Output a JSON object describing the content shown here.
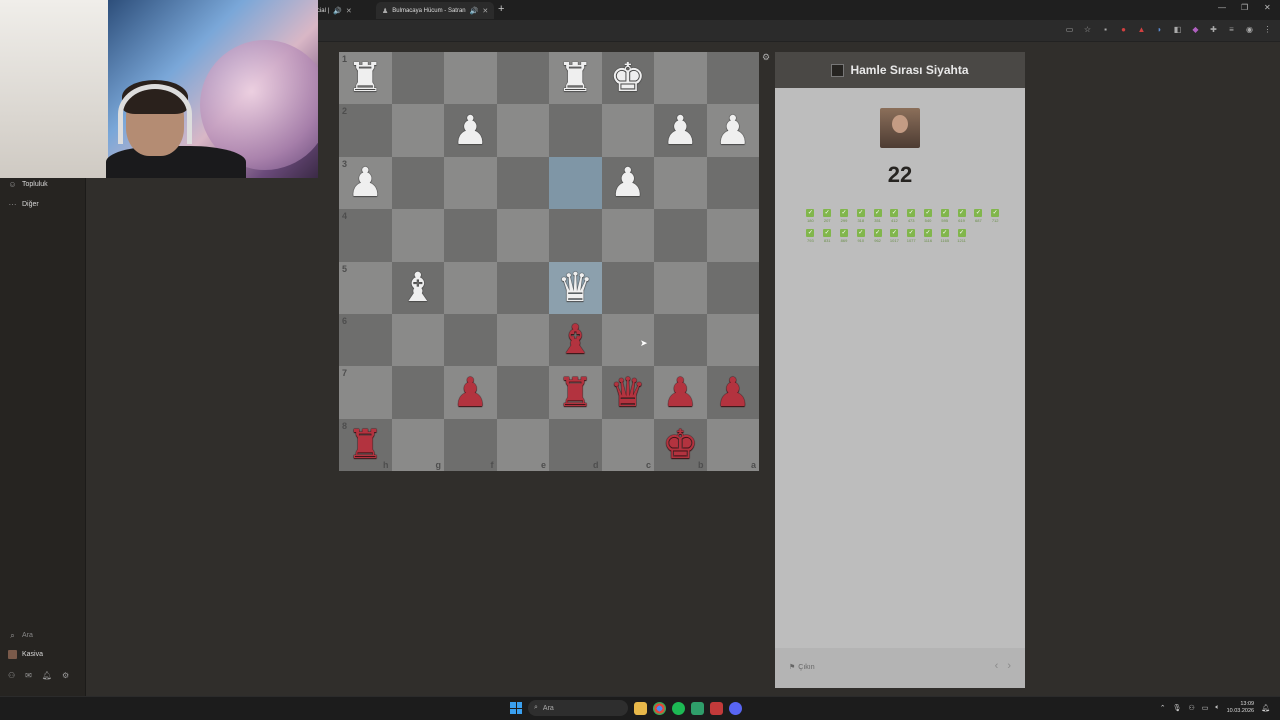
{
  "browser": {
    "tabs": [
      {
        "label": "[Official |",
        "audio": "🔊"
      },
      {
        "label": "Bulmacaya Hücum - Satran",
        "audio": "🔊"
      }
    ],
    "new_tab": "+",
    "window_controls": [
      "—",
      "❐",
      "✕"
    ]
  },
  "sidebar": {
    "items": [
      {
        "icon": "community-icon",
        "label": "Topluluk"
      },
      {
        "icon": "more-icon",
        "label": "Diğer"
      }
    ],
    "search_label": "Ara",
    "user_label": "Kasiva"
  },
  "board": {
    "ranks": [
      "1",
      "2",
      "3",
      "4",
      "5",
      "6",
      "7",
      "8"
    ],
    "files": [
      "h",
      "g",
      "f",
      "e",
      "d",
      "c",
      "b",
      "a"
    ],
    "squares": [
      [
        "♜w",
        "",
        "",
        "",
        "♜w",
        "♚w",
        "",
        ""
      ],
      [
        "",
        "",
        "♟w",
        "",
        "",
        "",
        "♟w",
        "♟w"
      ],
      [
        "♟w",
        "",
        "",
        "",
        "",
        "♟w",
        "",
        ""
      ],
      [
        "",
        "",
        "",
        "",
        "",
        "",
        "",
        ""
      ],
      [
        "",
        "♝w",
        "",
        "",
        "♛w",
        "",
        "",
        ""
      ],
      [
        "",
        "",
        "",
        "",
        "♝b",
        "",
        "",
        ""
      ],
      [
        "",
        "",
        "♟b",
        "",
        "♜b",
        "♛b",
        "♟b",
        "♟b"
      ],
      [
        "♜b",
        "",
        "",
        "",
        "",
        "",
        "♚b",
        ""
      ]
    ],
    "highlighted": [
      [
        2,
        4
      ],
      [
        4,
        4
      ]
    ]
  },
  "panel": {
    "title": "Hamle Sırası Siyahta",
    "score": "22",
    "ratings": [
      "180",
      "207",
      "299",
      "318",
      "351",
      "412",
      "473",
      "540",
      "595",
      "619",
      "687",
      "712",
      "793",
      "831",
      "869",
      "910",
      "962",
      "1017",
      "1077",
      "1116",
      "1165",
      "1211"
    ],
    "exit_label": "Çıkın",
    "prev_arrow": "‹",
    "next_arrow": "›"
  },
  "taskbar": {
    "search_placeholder": "Ara",
    "time": "13:09",
    "date": "10.03.2026"
  }
}
